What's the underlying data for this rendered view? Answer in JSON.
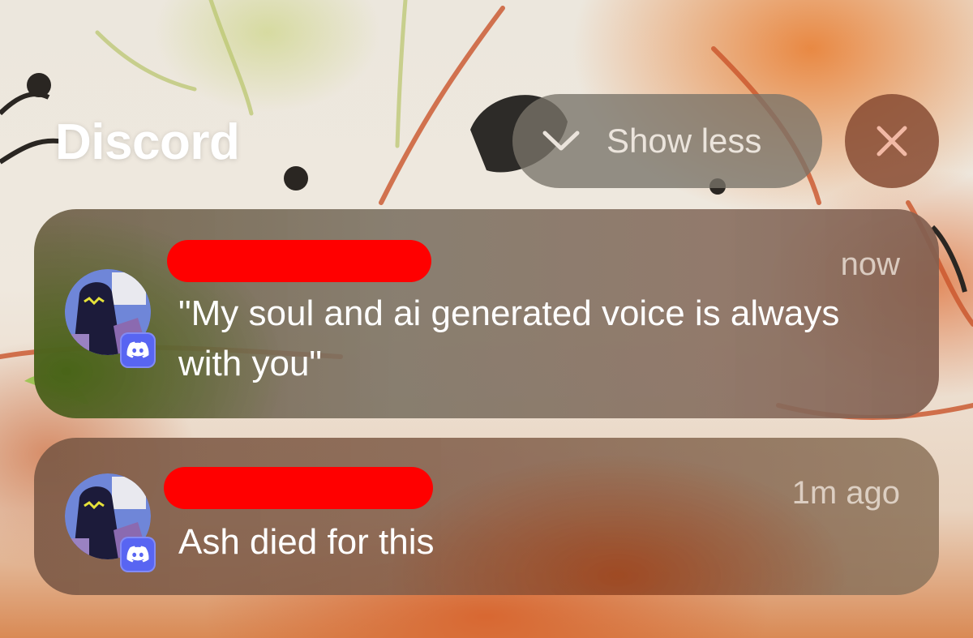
{
  "app": {
    "title": "Discord"
  },
  "controls": {
    "show_less_label": "Show less",
    "show_less_icon": "chevron-down-icon",
    "close_icon": "close-icon"
  },
  "notifications": [
    {
      "sender": "",
      "sender_redacted": true,
      "time": "now",
      "message": "\"My soul and ai generated voice is always with you\"",
      "app_badge_icon": "discord-icon"
    },
    {
      "sender": "",
      "sender_redacted": true,
      "time": "1m ago",
      "message": "Ash died for this",
      "app_badge_icon": "discord-icon"
    }
  ],
  "colors": {
    "discord_blurple": "#5865f2",
    "redaction": "#ff0000",
    "text_primary": "#ffffff"
  }
}
